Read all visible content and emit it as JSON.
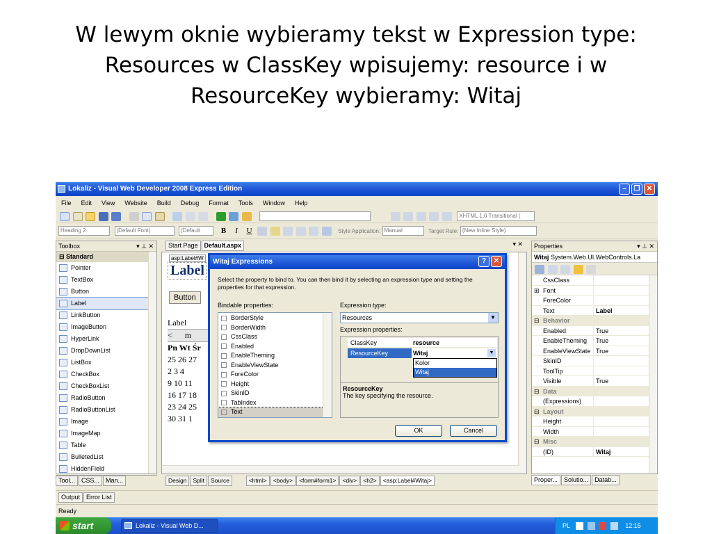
{
  "slide": {
    "title": "W lewym oknie wybieramy tekst w Expression type: Resources w ClassKey wpisujemy: resource i w ResourceKey wybieramy: Witaj"
  },
  "window": {
    "title": "Lokaliz - Visual Web Developer 2008 Express Edition"
  },
  "menu": [
    "File",
    "Edit",
    "View",
    "Website",
    "Build",
    "Debug",
    "Format",
    "Tools",
    "Window",
    "Help"
  ],
  "toolbar": {
    "doctype": "XHTML 1.0 Transitional (",
    "block_format": "Heading 2",
    "font_name": "(Default Font)",
    "font_size": "(Default",
    "style_app_label": "Style Application:",
    "style_app_value": "Manual",
    "target_rule_label": "Target Rule:",
    "target_rule_value": "(New Inline Style)"
  },
  "toolbox": {
    "title": "Toolbox",
    "group": "Standard",
    "items": [
      {
        "label": "Pointer",
        "icon": "pointer-icon"
      },
      {
        "label": "TextBox",
        "icon": "textbox-icon"
      },
      {
        "label": "Button",
        "icon": "button-icon"
      },
      {
        "label": "Label",
        "icon": "label-icon"
      },
      {
        "label": "LinkButton",
        "icon": "linkbutton-icon"
      },
      {
        "label": "ImageButton",
        "icon": "imagebutton-icon"
      },
      {
        "label": "HyperLink",
        "icon": "hyperlink-icon"
      },
      {
        "label": "DropDownList",
        "icon": "dropdownlist-icon"
      },
      {
        "label": "ListBox",
        "icon": "listbox-icon"
      },
      {
        "label": "CheckBox",
        "icon": "checkbox-icon"
      },
      {
        "label": "CheckBoxList",
        "icon": "checkboxlist-icon"
      },
      {
        "label": "RadioButton",
        "icon": "radiobutton-icon"
      },
      {
        "label": "RadioButtonList",
        "icon": "radiobuttonlist-icon"
      },
      {
        "label": "Image",
        "icon": "image-icon"
      },
      {
        "label": "ImageMap",
        "icon": "imagemap-icon"
      },
      {
        "label": "Table",
        "icon": "table-icon"
      },
      {
        "label": "BulletedList",
        "icon": "bulletedlist-icon"
      },
      {
        "label": "HiddenField",
        "icon": "hiddenfield-icon"
      }
    ],
    "bottom_tabs": [
      "Tool...",
      "CSS...",
      "Man..."
    ]
  },
  "editor": {
    "tabs": [
      "Start Page",
      "Default.aspx"
    ],
    "tag_label": "asp:Label#W",
    "label_text": "Label",
    "button_text": "Button",
    "label2": "Label",
    "cal_prev": "<",
    "cal_m": "m",
    "cal_days": "Pn  Wt  Śr",
    "cal_rows": [
      "25 26 27",
      "2  3  4",
      "9  10 11",
      "16 17 18",
      "23 24 25",
      "30 31  1"
    ],
    "views": [
      "Design",
      "Split",
      "Source"
    ],
    "crumbs": [
      "<html>",
      "<body>",
      "<form#form1>",
      "<div>",
      "<h2>",
      "<asp:Label#Witaj>"
    ]
  },
  "dialog": {
    "title": "Witaj Expressions",
    "intro": "Select the property to bind to.  You can then bind it by selecting an expression type and setting the properties for that expression.",
    "bindable_label": "Bindable properties:",
    "props": [
      "BorderStyle",
      "BorderWidth",
      "CssClass",
      "Enabled",
      "EnableTheming",
      "EnableViewState",
      "ForeColor",
      "Height",
      "SkinID",
      "TabIndex",
      "Text"
    ],
    "expr_type_label": "Expression type:",
    "expr_type_value": "Resources",
    "expr_props_label": "Expression properties:",
    "classkey_label": "ClassKey",
    "classkey_value": "resource",
    "resourcekey_label": "ResourceKey",
    "resourcekey_value": "Witaj",
    "dropdown": [
      "Kolor",
      "Witaj"
    ],
    "desc_title": "ResourceKey",
    "desc_text": "The key specifying the resource.",
    "ok": "OK",
    "cancel": "Cancel"
  },
  "properties": {
    "title": "Properties",
    "object_name": "Witaj",
    "object_type": "System.Web.UI.WebControls.La",
    "rows": [
      {
        "name": "CssClass",
        "value": ""
      },
      {
        "name": "Font",
        "value": ""
      },
      {
        "name": "ForeColor",
        "value": ""
      },
      {
        "name": "Text",
        "value": "Label"
      }
    ],
    "behavior": "Behavior",
    "behavior_rows": [
      {
        "name": "Enabled",
        "value": "True"
      },
      {
        "name": "EnableTheming",
        "value": "True"
      },
      {
        "name": "EnableViewState",
        "value": "True"
      },
      {
        "name": "SkinID",
        "value": ""
      },
      {
        "name": "ToolTip",
        "value": ""
      },
      {
        "name": "Visible",
        "value": "True"
      }
    ],
    "data": "Data",
    "data_rows": [
      {
        "name": "(Expressions)",
        "value": ""
      }
    ],
    "layout": "Layout",
    "layout_rows": [
      {
        "name": "Height",
        "value": ""
      },
      {
        "name": "Width",
        "value": ""
      }
    ],
    "misc": "Misc",
    "misc_rows": [
      {
        "name": "(ID)",
        "value": "Witaj"
      }
    ],
    "bottom_tabs": [
      "Proper...",
      "Solutio...",
      "Datab..."
    ]
  },
  "output_tabs": [
    "Output",
    "Error List"
  ],
  "status": "Ready",
  "taskbar": {
    "start": "start",
    "task": "Lokaliz - Visual Web D...",
    "lang": "PL",
    "time": "12:15"
  }
}
